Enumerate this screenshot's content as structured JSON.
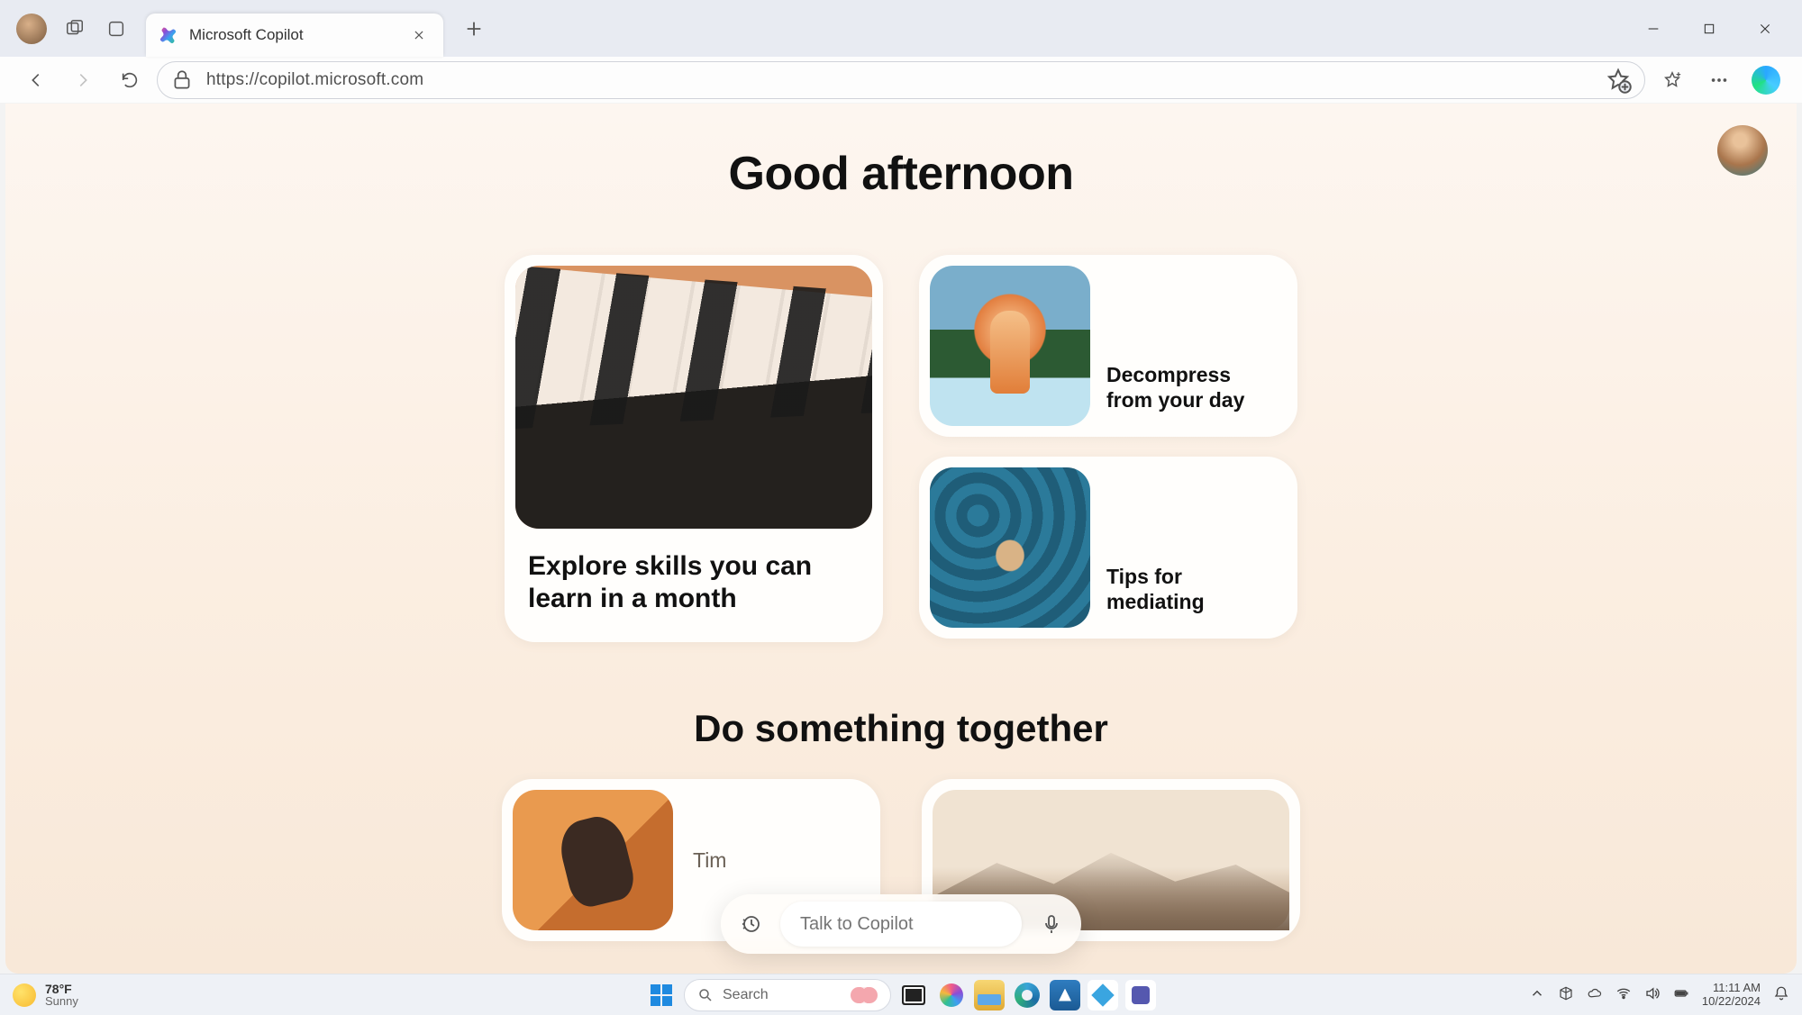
{
  "browser": {
    "tab_title": "Microsoft Copilot",
    "url": "https://copilot.microsoft.com"
  },
  "page": {
    "greeting": "Good afternoon",
    "cards": {
      "big_title": "Explore skills you can learn in a month",
      "decompress": "Decompress from your day",
      "mediating": "Tips for mediating"
    },
    "section2_title": "Do something together",
    "bottom_partial_text": "Tim",
    "talk": {
      "placeholder": "Talk to Copilot"
    }
  },
  "taskbar": {
    "weather_temp": "78°F",
    "weather_cond": "Sunny",
    "search_placeholder": "Search",
    "time": "11:11 AM",
    "date": "10/22/2024"
  }
}
